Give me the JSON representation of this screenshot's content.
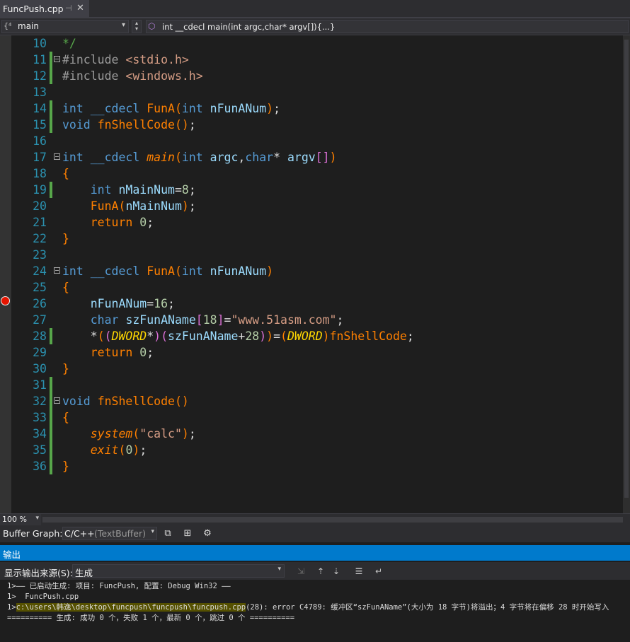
{
  "tab": {
    "title": "FuncPush.cpp",
    "pin": "⊣",
    "close": "✕"
  },
  "nav": {
    "scope_icon": "{⁴",
    "scope": "main",
    "member_icon": "⬡",
    "member": "int __cdecl main(int argc,char* argv[]){...}"
  },
  "line_numbers": [
    "10",
    "11",
    "12",
    "13",
    "14",
    "15",
    "16",
    "17",
    "18",
    "19",
    "20",
    "21",
    "22",
    "23",
    "24",
    "25",
    "26",
    "27",
    "28",
    "29",
    "30",
    "31",
    "32",
    "33",
    "34",
    "35",
    "36"
  ],
  "code": {
    "l10": "*/",
    "l11a": "#include ",
    "l11b": "<stdio.h>",
    "l12a": "#include ",
    "l12b": "<windows.h>",
    "l14": [
      "int",
      " __cdecl ",
      "FunA",
      "(",
      "int",
      " ",
      "nFunANum",
      ")",
      ";"
    ],
    "l15": [
      "void",
      " ",
      "fnShellCode",
      "()",
      ";"
    ],
    "l17": [
      "int",
      " __cdecl ",
      "main",
      "(",
      "int",
      " ",
      "argc",
      ",",
      "char",
      "* ",
      "argv",
      "[]",
      ")"
    ],
    "l18": "{",
    "l19": [
      "    ",
      "int",
      " ",
      "nMainNum",
      "=",
      "8",
      ";"
    ],
    "l20": [
      "    ",
      "FunA",
      "(",
      "nMainNum",
      ")",
      ";"
    ],
    "l21": [
      "    ",
      "return",
      " ",
      "0",
      ";"
    ],
    "l22": "}",
    "l24": [
      "int",
      " __cdecl ",
      "FunA",
      "(",
      "int",
      " ",
      "nFunANum",
      ")"
    ],
    "l25": "{",
    "l26": [
      "    ",
      "nFunANum",
      "=",
      "16",
      ";"
    ],
    "l27": [
      "    ",
      "char",
      " ",
      "szFunAName",
      "[",
      "18",
      "]",
      "=",
      "\"www.51asm.com\"",
      ";"
    ],
    "l28": [
      "    ",
      "*",
      "(",
      "(",
      "DWORD",
      "*",
      ")",
      "(",
      "szFunAName",
      "+",
      "28",
      ")",
      ")",
      "=",
      "(",
      "DWORD",
      ")",
      "fnShellCode",
      ";"
    ],
    "l29": [
      "    ",
      "return",
      " ",
      "0",
      ";"
    ],
    "l30": "}",
    "l32": [
      "void",
      " ",
      "fnShellCode",
      "()"
    ],
    "l33": "{",
    "l34": [
      "    ",
      "system",
      "(",
      "\"calc\"",
      ")",
      ";"
    ],
    "l35": [
      "    ",
      "exit",
      "(",
      "0",
      ")",
      ";"
    ],
    "l36": "}"
  },
  "editor_bottom": {
    "zoom": "100 %"
  },
  "buffer_graph": {
    "label": "Buffer Graph:",
    "lang": "C/C++",
    "buffer": "(TextBuffer)"
  },
  "output": {
    "title": "输出",
    "source_label": "显示输出来源(S):",
    "source_value": "生成",
    "lines": [
      "1>—— 已启动生成: 项目: FuncPush, 配置: Debug Win32 ——",
      "1>  FuncPush.cpp",
      "1>",
      "c:\\users\\韩逸\\desktop\\funcpush\\funcpush\\funcpush.cpp",
      "(28): error C4789: 缓冲区“szFunAName”(大小为 18 字节)将溢出；4 字节将在偏移 28 时开始写入",
      "========== 生成: 成功 0 个，失败 1 个，最新 0 个，跳过 0 个 =========="
    ]
  },
  "colors": {
    "accent": "#007acc",
    "breakpoint": "#e51400",
    "changed_saved": "#57a64a",
    "changed_unsaved": "#6c6c00"
  }
}
